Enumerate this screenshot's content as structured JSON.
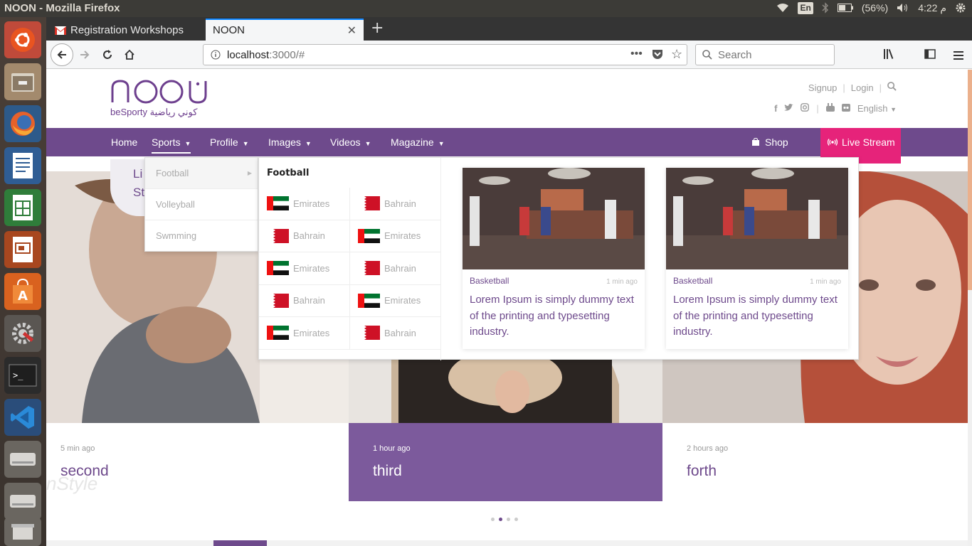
{
  "os": {
    "window_title": "NOON - Mozilla Firefox",
    "keyboard": "En",
    "battery": "(56%)",
    "clock": "4:22 م"
  },
  "browser": {
    "tabs": [
      {
        "label": "Registration Workshops"
      },
      {
        "label": "NOON"
      }
    ],
    "url_host": "localhost",
    "url_rest": ":3000/#",
    "search_placeholder": "Search"
  },
  "site": {
    "logo_word": "noon",
    "logo_tagline": "beSporty كوني رياضية",
    "top_links": [
      "Signup",
      "Login"
    ],
    "language": "English",
    "nav": {
      "items": [
        "Home",
        "Sports",
        "Profile",
        "Images",
        "Videos",
        "Magazine"
      ],
      "shop": "Shop",
      "live_stream": "Live Stream"
    },
    "live_bubble_lines": [
      "Li",
      "Stre"
    ],
    "slides": [
      {
        "time": "5 min ago",
        "title": "second"
      },
      {
        "time": "1 hour ago",
        "title": "third"
      },
      {
        "time": "2 hours ago",
        "title": "forth"
      }
    ],
    "slide_watermark": "nStyle",
    "dropdown": {
      "sports": [
        "Football",
        "Volleyball",
        "Swmming"
      ],
      "heading": "Football",
      "flag_rows": [
        [
          "Emirates",
          "Bahrain"
        ],
        [
          "Bahrain",
          "Emirates"
        ],
        [
          "Emirates",
          "Bahrain"
        ],
        [
          "Bahrain",
          "Emirates"
        ],
        [
          "Emirates",
          "Bahrain"
        ]
      ],
      "cards": [
        {
          "category": "Basketball",
          "time": "1 min ago",
          "title": "Lorem Ipsum is simply dummy text of the printing and typesetting industry."
        },
        {
          "category": "Basketball",
          "time": "1 min ago",
          "title": "Lorem Ipsum is simply dummy text of the printing and typesetting industry."
        }
      ]
    }
  },
  "colors": {
    "brand_purple": "#6e4a8c",
    "live_pink": "#e6237a"
  }
}
